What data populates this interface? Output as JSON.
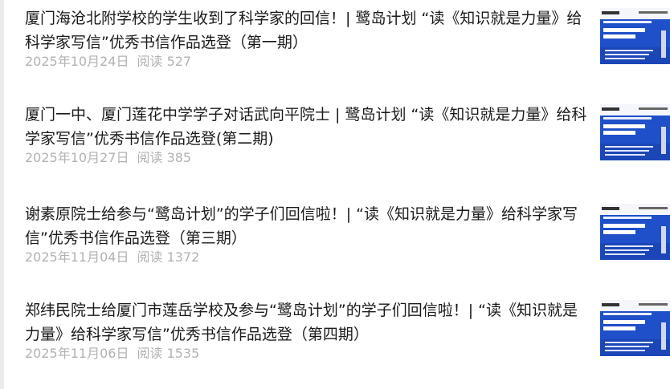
{
  "articles": [
    {
      "title": "厦门海沧北附学校的学生收到了科学家的回信！| 鹭岛计划 “读《知识就是力量》给科学家写信”优秀书信作品选登（第一期）",
      "date": "2025年10月24日",
      "read_label": "阅读",
      "read_count": "527"
    },
    {
      "title": "厦门一中、厦门莲花中学学子对话武向平院士 | 鹭岛计划 “读《知识就是力量》给科学家写信”优秀书信作品选登(第二期)",
      "date": "2025年10月27日",
      "read_label": "阅读",
      "read_count": "385"
    },
    {
      "title": "谢素原院士给参与“鹭岛计划”的学子们回信啦！| “读《知识就是力量》给科学家写信”优秀书信作品选登（第三期）",
      "date": "2025年11月04日",
      "read_label": "阅读",
      "read_count": "1372"
    },
    {
      "title": "郑纬民院士给厦门市莲岳学校及参与“鹭岛计划”的学子们回信啦！| “读《知识就是力量》给科学家写信”优秀书信作品选登（第四期）",
      "date": "2025年11月06日",
      "read_label": "阅读",
      "read_count": "1535"
    }
  ],
  "colors": {
    "title": "#1a1a1a",
    "meta": "#b2b2b2",
    "thumb_blue": "#1f4fc9",
    "rail": "#ececec"
  }
}
